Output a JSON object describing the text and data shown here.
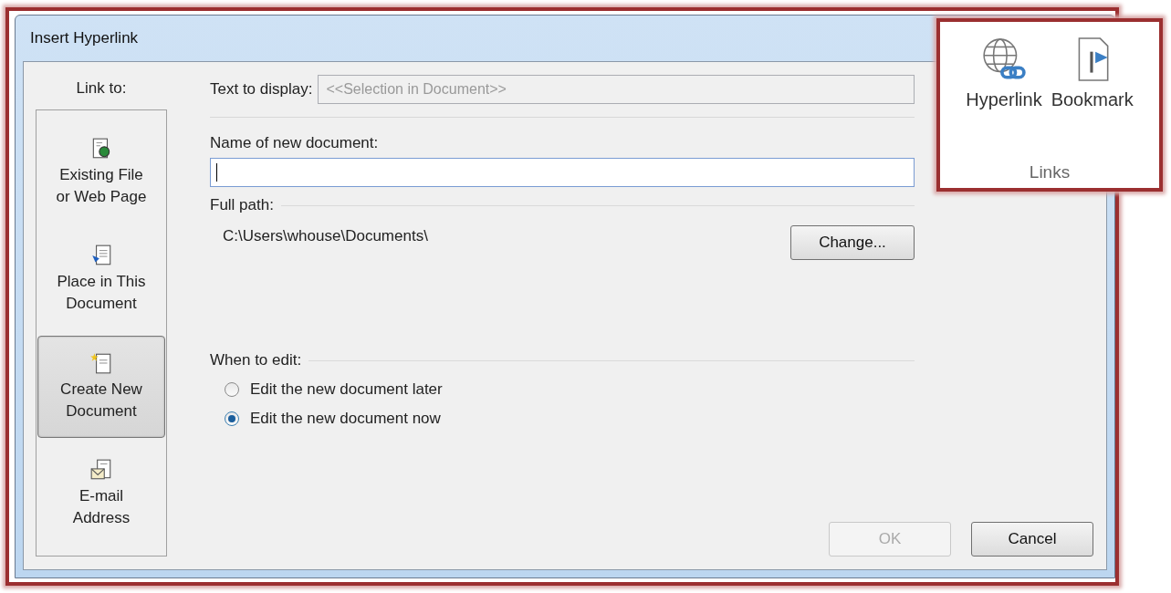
{
  "window": {
    "title": "Insert Hyperlink"
  },
  "link_to": {
    "label": "Link to:",
    "items": [
      {
        "label": "Existing File\nor Web Page",
        "kind": "file",
        "selected": false
      },
      {
        "label": "Place in This\nDocument",
        "kind": "place",
        "selected": false
      },
      {
        "label": "Create New\nDocument",
        "kind": "new",
        "selected": true
      },
      {
        "label": "E-mail\nAddress",
        "kind": "email",
        "selected": false
      }
    ]
  },
  "text_to_display": {
    "label": "Text to display:",
    "value": "<<Selection in Document>>",
    "disabled": true
  },
  "new_document": {
    "label": "Name of new document:",
    "focused": true
  },
  "full_path": {
    "label": "Full path:",
    "path": "C:\\Users\\whouse\\Documents\\",
    "button": "Change..."
  },
  "when_to_edit": {
    "label": "When to edit:",
    "options": [
      {
        "label": "Edit the new document later",
        "selected": false
      },
      {
        "label": "Edit the new document now",
        "selected": true
      }
    ]
  },
  "buttons": [
    {
      "label": "OK",
      "disabled": true
    },
    {
      "label": "Cancel",
      "disabled": false
    }
  ],
  "ribbon_callout": {
    "items": [
      {
        "label": "Hyperlink",
        "kind": "hyperlink"
      },
      {
        "label": "Bookmark",
        "kind": "bookmark"
      }
    ],
    "group_label": "Links"
  }
}
